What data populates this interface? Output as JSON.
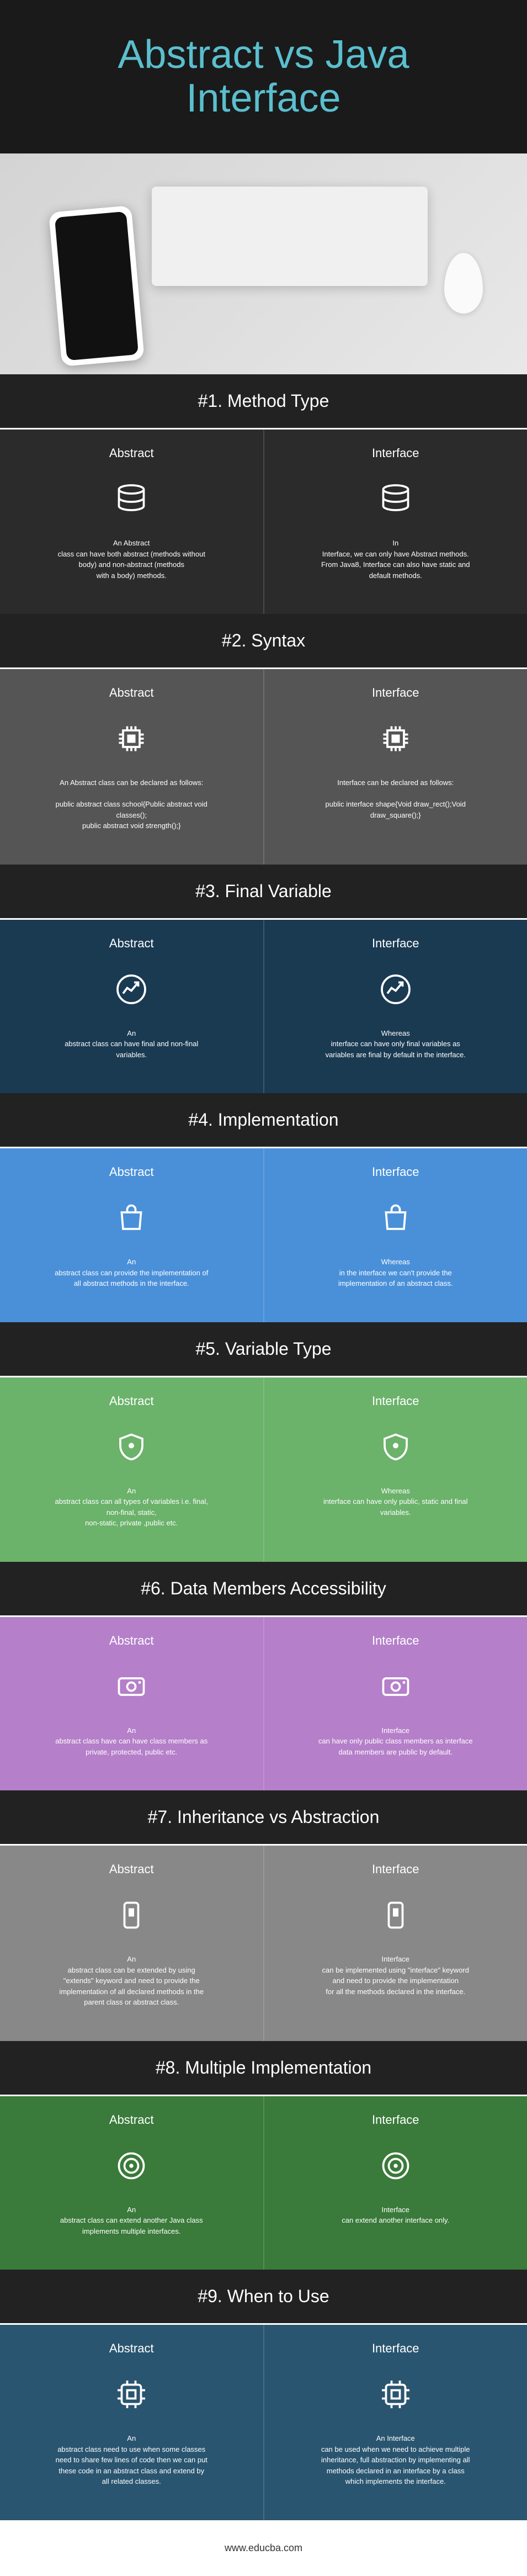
{
  "title_line1": "Abstract vs Java",
  "title_line2": "Interface",
  "footer": "www.educba.com",
  "col_labels": {
    "left": "Abstract",
    "right": "Interface"
  },
  "sections": [
    {
      "num": "#1. Method  Type",
      "icon": "db",
      "left": "An Abstract\nclass can have both abstract (methods without body) and non-abstract (methods\nwith a body) methods.",
      "right": "In\nInterface, we can only have Abstract methods. From Java8, Interface can also have static and default methods."
    },
    {
      "num": "#2. Syntax",
      "icon": "chip",
      "left": "An Abstract class can be declared as follows:\n\npublic abstract class school{Public abstract void classes();\npublic abstract void strength();}",
      "right": "Interface can be declared as follows:\n\npublic interface shape{Void draw_rect();Void draw_square();}"
    },
    {
      "num": "#3. Final Variable",
      "icon": "chart",
      "left": "An\nabstract class can have final and non-final variables.",
      "right": "Whereas\ninterface can have only final variables as variables are final by default in the interface."
    },
    {
      "num": "#4. Implementation",
      "icon": "bag",
      "left": "An\nabstract class can provide the implementation of all abstract methods in the interface.",
      "right": "Whereas\nin the interface we can't provide the implementation of an abstract class."
    },
    {
      "num": "#5. Variable Type",
      "icon": "shield",
      "left": "An\nabstract class can all types of variables i.e. final, non-final, static,\nnon-static, private ,public etc.",
      "right": "Whereas\ninterface can have only public, static and final variables."
    },
    {
      "num": "#6. Data Members Accessibility",
      "icon": "disk",
      "left": "An\nabstract class have can have class members as private, protected, public etc.",
      "right": "Interface\ncan have only public class members as interface data members are public by default."
    },
    {
      "num": "#7. Inheritance vs Abstraction",
      "icon": "device",
      "left": "An\nabstract class can be extended by using \"extends\" keyword and need to provide the implementation of all declared methods in the parent class or abstract class.",
      "right": "Interface\ncan be implemented using \"interface\" keyword and need to provide the implementation\nfor all the methods declared in the interface."
    },
    {
      "num": "#8. Multiple Implementation",
      "icon": "target",
      "left": "An\nabstract class can extend another Java class implements multiple interfaces.",
      "right": "Interface\ncan extend another interface only."
    },
    {
      "num": "#9. When to Use",
      "icon": "cpu",
      "left": "An\nabstract class need to use when some classes need to share few lines of code then we can put these code in an abstract class and extend by all related classes.",
      "right": "An Interface\ncan be used when we need to achieve multiple inheritance, full abstraction by implementing all methods declared in an interface by a class which implements the interface."
    }
  ]
}
